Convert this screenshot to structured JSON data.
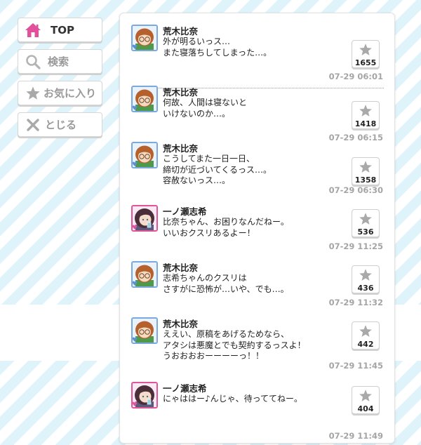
{
  "menu": {
    "items": [
      {
        "label": "TOP",
        "icon": "home-icon",
        "color": "#e24f9a",
        "active": true
      },
      {
        "label": "検索",
        "icon": "search-icon",
        "active": false
      },
      {
        "label": "お気に入り",
        "icon": "star-icon",
        "active": false
      },
      {
        "label": "とじる",
        "icon": "close-icon",
        "active": false
      }
    ]
  },
  "timeline": {
    "posts": [
      {
        "name": "荒木比奈",
        "avatar": "hina-avatar",
        "lines": [
          "外が明るいっス…",
          "また寝落ちしてしまった…。"
        ],
        "favorites": "1655",
        "time": "07-29 06:01"
      },
      {
        "name": "荒木比奈",
        "avatar": "hina-avatar",
        "lines": [
          "何故、人間は寝ないと",
          "いけないのか…。"
        ],
        "favorites": "1418",
        "time": "07-29 06:15"
      },
      {
        "name": "荒木比奈",
        "avatar": "hina-avatar",
        "lines": [
          "こうしてまた一日一日、",
          "締切が近づいてくるっス…。",
          "容赦ないっス…。"
        ],
        "favorites": "1358",
        "time": "07-29 06:30"
      },
      {
        "name": "一ノ瀬志希",
        "avatar": "shiki-avatar",
        "lines": [
          "比奈ちゃん、お困りなんだねー。",
          "いいおクスリあるよー！"
        ],
        "favorites": "536",
        "time": "07-29 11:25"
      },
      {
        "name": "荒木比奈",
        "avatar": "hina-avatar",
        "lines": [
          "志希ちゃんのクスリは",
          "さすがに恐怖が…いや、でも…。"
        ],
        "favorites": "436",
        "time": "07-29 11:32"
      },
      {
        "name": "荒木比奈",
        "avatar": "hina-avatar",
        "lines": [
          "ええい、原稿をあげるためなら、",
          "アタシは悪魔とでも契約するっスよ！",
          "うおおおおーーーーっ！！"
        ],
        "favorites": "442",
        "time": "07-29 11:45"
      },
      {
        "name": "一ノ瀬志希",
        "avatar": "shiki-avatar",
        "lines": [
          "にゃははー♪んじゃ、待っててねー。"
        ],
        "favorites": "404",
        "time": "07-29 11:49"
      }
    ]
  },
  "colors": {
    "accent": "#e24f9a",
    "star": "#a9a9a9",
    "time": "#a5a5a5"
  }
}
